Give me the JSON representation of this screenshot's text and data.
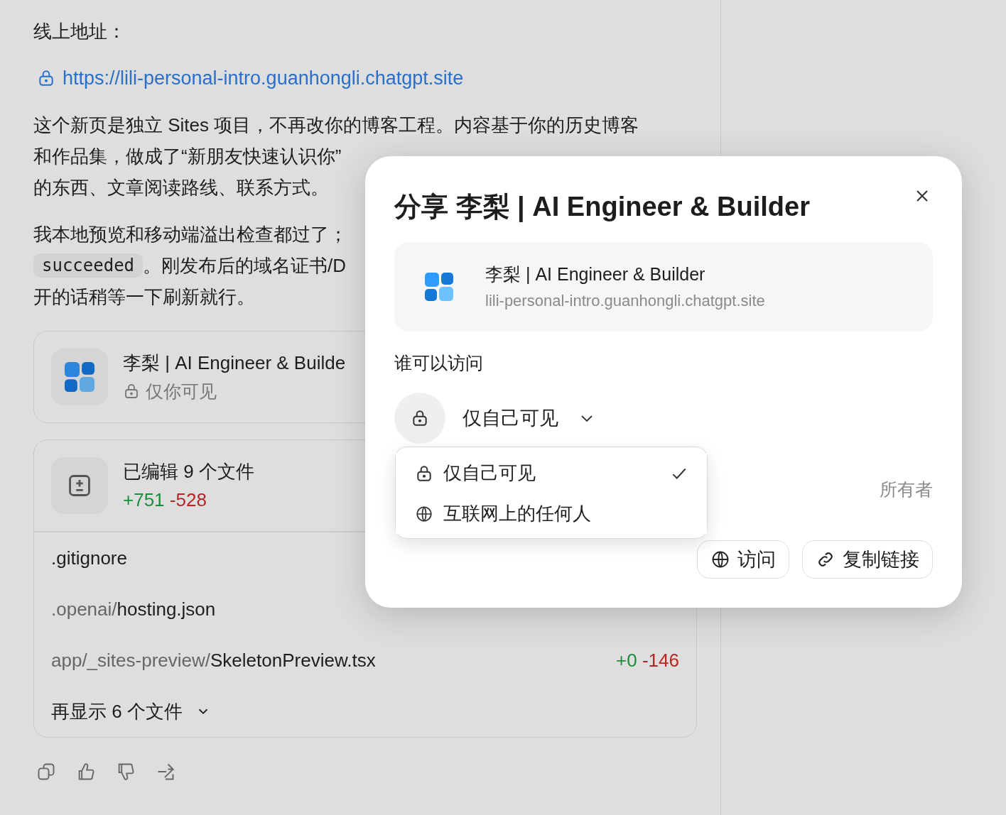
{
  "page": {
    "heading": "线上地址：",
    "link": "https://lili-personal-intro.guanhongli.chatgpt.site",
    "paragraphs": [
      {
        "lines": [
          {
            "text": "这个新页是独立 Sites 项目，不再改你的博客工程。内容基于你的历史博客"
          },
          {
            "text": "和作品集，做成了“新朋友快速认识你”"
          },
          {
            "text": "的东西、文章阅读路线、联系方式。"
          }
        ]
      },
      {
        "lines": [
          {
            "text": "我本地预览和移动端溢出检查都过了；"
          },
          {
            "code": "succeeded",
            "text": "。刚发布后的域名证书/D"
          },
          {
            "text": "开的话稍等一下刷新就行。"
          }
        ]
      }
    ]
  },
  "site_card": {
    "title": "李梨 | AI Engineer & Builde",
    "visibility": "仅你可见"
  },
  "files_card": {
    "title": "已编辑 9 个文件",
    "added": "+751",
    "removed": "-528",
    "files": [
      {
        "name": ".gitignore"
      },
      {
        "dir": ".openai/",
        "name": "hosting.json"
      },
      {
        "dir": "app/_sites-preview/",
        "name": "SkeletonPreview.tsx",
        "added": "+0",
        "removed": "-146"
      }
    ],
    "more": "再显示 6 个文件"
  },
  "dialog": {
    "title": "分享 李梨 | AI Engineer & Builder",
    "site_title": "李梨 | AI Engineer & Builder",
    "site_url": "lili-personal-intro.guanhongli.chatgpt.site",
    "access_label": "谁可以访问",
    "access_value": "仅自己可见",
    "owner_label": "所有者",
    "buttons": [
      {
        "label": "访问",
        "kind": "globe"
      },
      {
        "label": "复制链接",
        "kind": "link"
      }
    ]
  },
  "dropdown": {
    "options": [
      {
        "label": "仅自己可见",
        "kind": "lock",
        "selected": true
      },
      {
        "label": "互联网上的任何人",
        "kind": "globe",
        "selected": false
      }
    ]
  }
}
